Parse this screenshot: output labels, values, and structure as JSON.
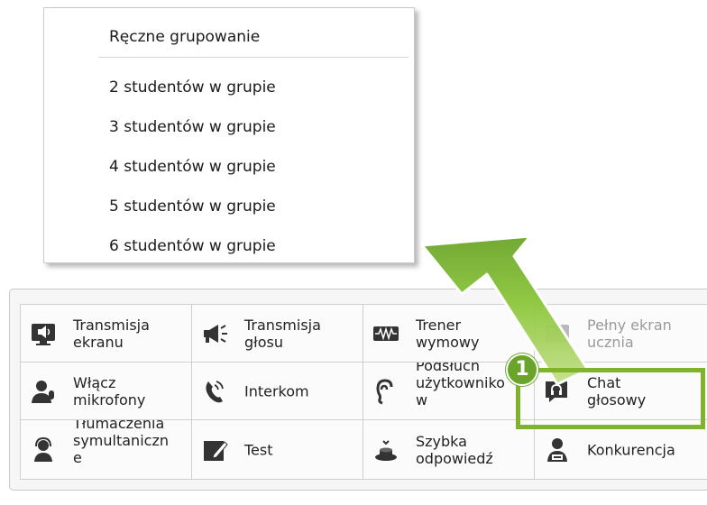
{
  "menu": {
    "items": [
      "Ręczne grupowanie",
      "2 studentów w grupie",
      "3 studentów w grupie",
      "4 studentów w grupie",
      "5 studentów w grupie",
      "6 studentów w grupie"
    ]
  },
  "toolbar": {
    "cells": [
      {
        "label": "Transmisja\nekranu",
        "icon": "screen-broadcast-icon"
      },
      {
        "label": "Transmisja\ngłosu",
        "icon": "megaphone-icon"
      },
      {
        "label": "Trener\nwymowy",
        "icon": "waveform-icon"
      },
      {
        "label": "Pełny ekran\nucznia",
        "icon": "fullscreen-icon"
      },
      {
        "label": "Włącz\nmikrofony",
        "icon": "microphone-user-icon"
      },
      {
        "label": "Interkom",
        "icon": "phone-icon"
      },
      {
        "label": "Podsłuch\nużytkowniko\nw",
        "icon": "ear-icon"
      },
      {
        "label": "Chat\ngłosowy",
        "icon": "headset-chat-icon"
      },
      {
        "label": "Tłumaczenia\nsymultaniczn\ne",
        "icon": "interpreter-icon"
      },
      {
        "label": "Test",
        "icon": "test-pencil-icon"
      },
      {
        "label": "Szybka\nodpowiedź",
        "icon": "buzzer-icon"
      },
      {
        "label": "Konkurencja",
        "icon": "competition-user-icon"
      }
    ]
  },
  "callout": {
    "number": "1"
  },
  "colors": {
    "accent_green": "#7fb32e",
    "badge_green": "#6aa42a"
  }
}
